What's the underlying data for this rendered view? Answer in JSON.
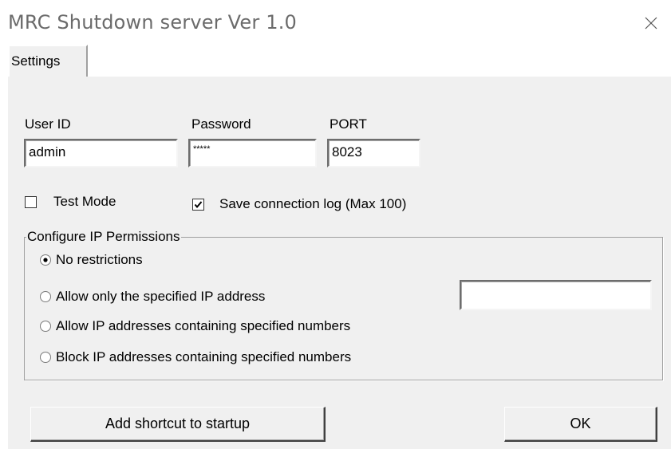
{
  "window": {
    "title": "MRC Shutdown server Ver 1.0",
    "close_icon": "close-icon"
  },
  "tabs": [
    {
      "label": "Settings",
      "active": true
    }
  ],
  "fields": {
    "user_id": {
      "label": "User ID",
      "value": "admin"
    },
    "password": {
      "label": "Password",
      "value": "*****"
    },
    "port": {
      "label": "PORT",
      "value": "8023"
    }
  },
  "checkboxes": {
    "test_mode": {
      "label": "Test Mode",
      "checked": false
    },
    "save_log": {
      "label": "Save connection log (Max 100)",
      "checked": true
    }
  },
  "ip_permissions": {
    "title": "Configure IP Permissions",
    "options": [
      {
        "label": "No restrictions",
        "selected": true
      },
      {
        "label": "Allow only the specified IP address",
        "selected": false
      },
      {
        "label": "Allow IP addresses containing specified numbers",
        "selected": false
      },
      {
        "label": "Block IP addresses containing specified numbers",
        "selected": false
      }
    ],
    "ip_value": ""
  },
  "buttons": {
    "startup": "Add shortcut to startup",
    "ok": "OK"
  }
}
